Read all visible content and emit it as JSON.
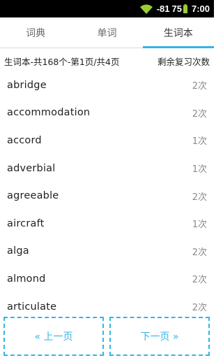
{
  "status_bar": {
    "signal": "-81",
    "battery": "75",
    "time": "7:00"
  },
  "tabs": [
    {
      "label": "词典",
      "active": false
    },
    {
      "label": "单词",
      "active": false
    },
    {
      "label": "生词本",
      "active": true
    }
  ],
  "summary": {
    "left": "生词本-共168个-第1页/共4页",
    "right": "剩余复习次数"
  },
  "words": [
    {
      "word": "abridge",
      "count": "2次"
    },
    {
      "word": "accommodation",
      "count": "2次"
    },
    {
      "word": "accord",
      "count": "1次"
    },
    {
      "word": "adverbial",
      "count": "1次"
    },
    {
      "word": "agreeable",
      "count": "2次"
    },
    {
      "word": "aircraft",
      "count": "1次"
    },
    {
      "word": "alga",
      "count": "2次"
    },
    {
      "word": "almond",
      "count": "2次"
    },
    {
      "word": "articulate",
      "count": "2次"
    }
  ],
  "pager": {
    "prev_label": "« 上一页",
    "next_label": "下一页 »"
  },
  "colors": {
    "accent": "#33b5e5",
    "status_bar": "#000000",
    "wifi": "#9acd32"
  }
}
